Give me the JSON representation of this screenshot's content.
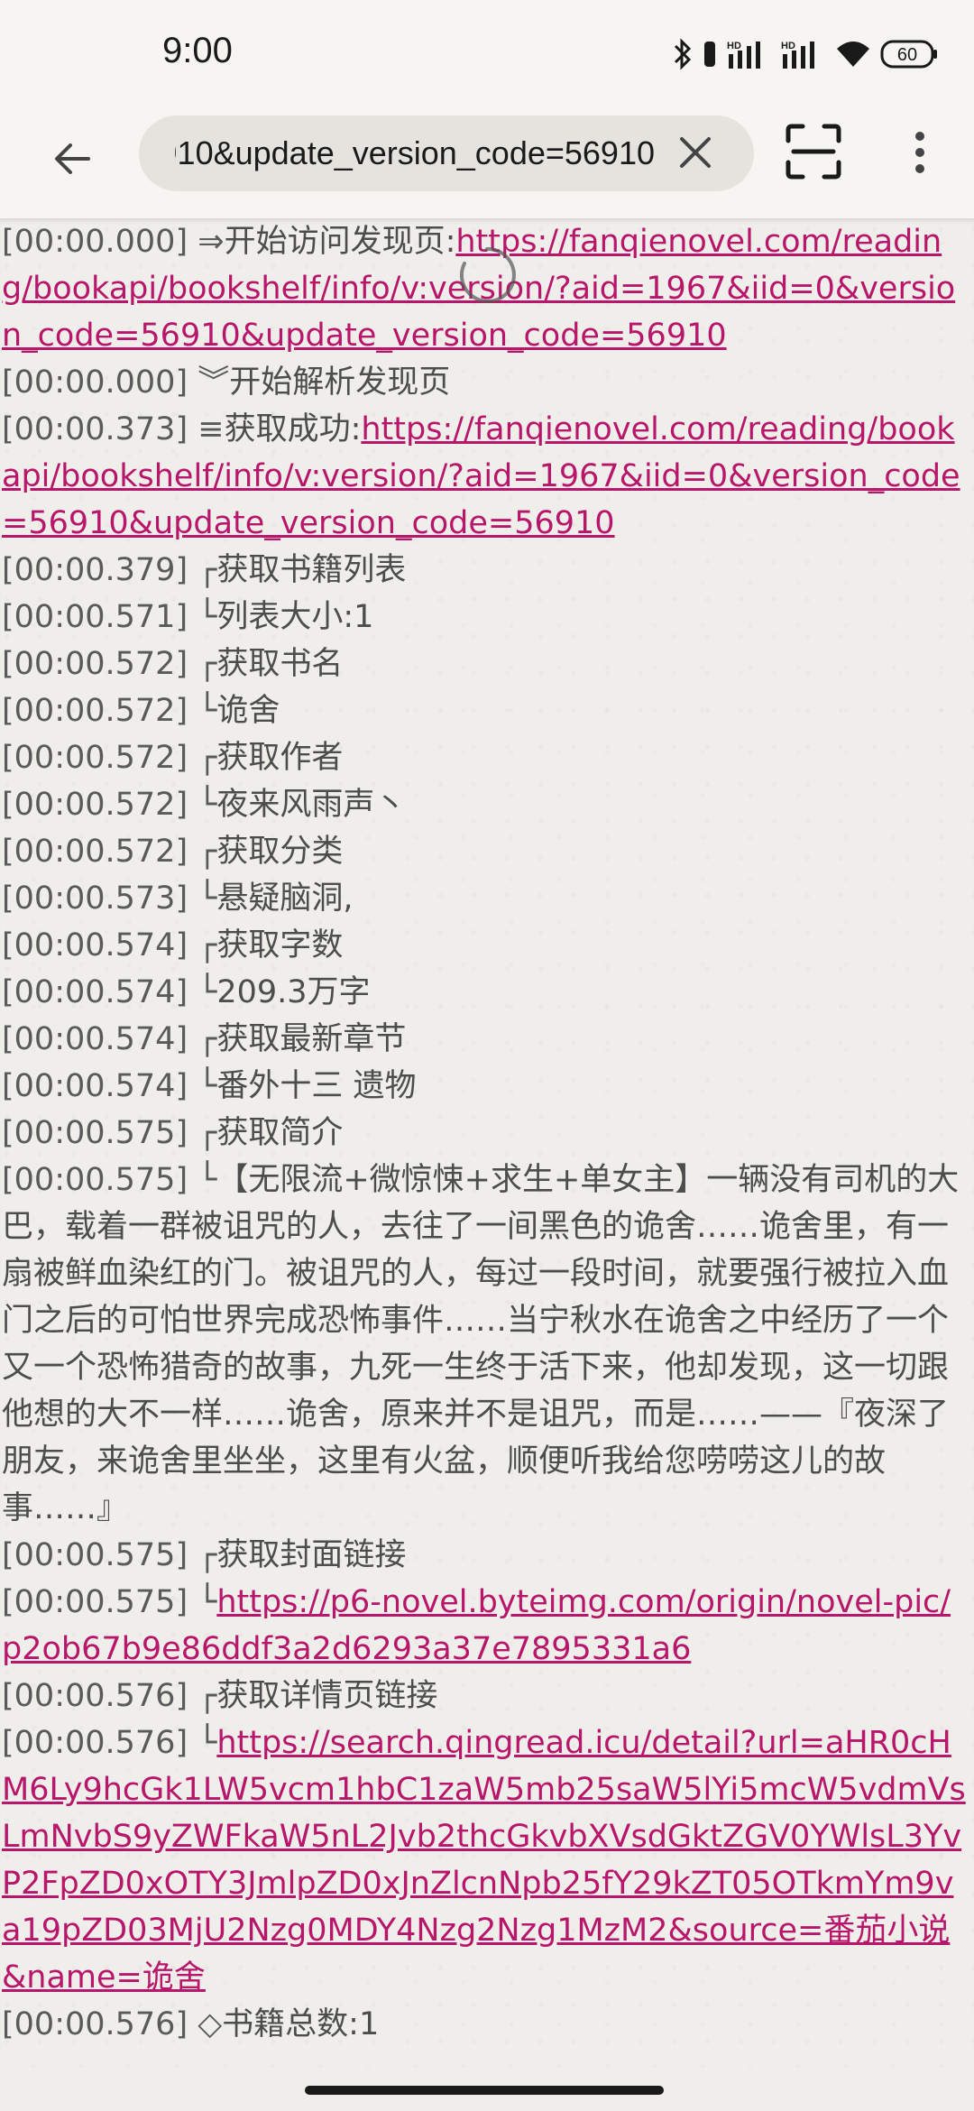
{
  "status_bar": {
    "time": "9:00",
    "battery": "60",
    "icons": [
      "bluetooth-icon",
      "vibrate-icon",
      "hd-signal-icon",
      "hd-signal-icon",
      "wifi-icon",
      "battery-icon"
    ]
  },
  "toolbar": {
    "url": "https://fanqienovel.com/reading/bookapi/bookshelf/info/v:version/?aid=1967&iid=0&version_code=56910&update_version_code=56910",
    "back_icon": "arrow-left-icon",
    "clear_icon": "close-icon",
    "scan_icon": "scan-icon",
    "more_icon": "more-vert-icon"
  },
  "log": [
    {
      "ts": "[00:00.000]",
      "marker": " ⇒",
      "text": "开始访问发现页:",
      "link": "https://fanqienovel.com/reading/bookapi/bookshelf/info/v:version/?aid=1967&iid=0&version_code=56910&update_version_code=56910"
    },
    {
      "ts": "[00:00.000]",
      "marker": " ︾",
      "text": "开始解析发现页",
      "link": ""
    },
    {
      "ts": "[00:00.373]",
      "marker": " ≡",
      "text": "获取成功:",
      "link": "https://fanqienovel.com/reading/bookapi/bookshelf/info/v:version/?aid=1967&iid=0&version_code=56910&update_version_code=56910"
    },
    {
      "ts": "[00:00.379]",
      "marker": " ┌",
      "text": "获取书籍列表",
      "link": ""
    },
    {
      "ts": "[00:00.571]",
      "marker": " └",
      "text": "列表大小:1",
      "link": ""
    },
    {
      "ts": "[00:00.572]",
      "marker": " ┌",
      "text": "获取书名",
      "link": ""
    },
    {
      "ts": "[00:00.572]",
      "marker": " └",
      "text": "诡舍",
      "link": ""
    },
    {
      "ts": "[00:00.572]",
      "marker": " ┌",
      "text": "获取作者",
      "link": ""
    },
    {
      "ts": "[00:00.572]",
      "marker": " └",
      "text": "夜来风雨声丶",
      "link": ""
    },
    {
      "ts": "[00:00.572]",
      "marker": " ┌",
      "text": "获取分类",
      "link": ""
    },
    {
      "ts": "[00:00.573]",
      "marker": " └",
      "text": "悬疑脑洞,",
      "link": ""
    },
    {
      "ts": "[00:00.574]",
      "marker": " ┌",
      "text": "获取字数",
      "link": ""
    },
    {
      "ts": "[00:00.574]",
      "marker": " └",
      "text": "209.3万字",
      "link": ""
    },
    {
      "ts": "[00:00.574]",
      "marker": " ┌",
      "text": "获取最新章节",
      "link": ""
    },
    {
      "ts": "[00:00.574]",
      "marker": " └",
      "text": "番外十三 遗物",
      "link": ""
    },
    {
      "ts": "[00:00.575]",
      "marker": " ┌",
      "text": "获取简介",
      "link": ""
    },
    {
      "ts": "[00:00.575]",
      "marker": " └",
      "text": "【无限流+微惊悚+求生+单女主】一辆没有司机的大巴，载着一群被诅咒的人，去往了一间黑色的诡舍……诡舍里，有一扇被鲜血染红的门。被诅咒的人，每过一段时间，就要强行被拉入血门之后的可怕世界完成恐怖事件……当宁秋水在诡舍之中经历了一个又一个恐怖猎奇的故事，九死一生终于活下来，他却发现，这一切跟他想的大不一样……诡舍，原来并不是诅咒，而是……——『夜深了朋友，来诡舍里坐坐，这里有火盆，顺便听我给您唠唠这儿的故事……』",
      "link": ""
    },
    {
      "ts": "[00:00.575]",
      "marker": " ┌",
      "text": "获取封面链接",
      "link": ""
    },
    {
      "ts": "[00:00.575]",
      "marker": " └",
      "text": "",
      "link": "https://p6-novel.byteimg.com/origin/novel-pic/p2ob67b9e86ddf3a2d6293a37e7895331a6"
    },
    {
      "ts": "[00:00.576]",
      "marker": " ┌",
      "text": "获取详情页链接",
      "link": ""
    },
    {
      "ts": "[00:00.576]",
      "marker": " └",
      "text": "",
      "link": "https://search.qingread.icu/detail?url=aHR0cHM6Ly9hcGk1LW5vcm1hbC1zaW5mb25saW5lYi5mcW5vdmVsLmNvbS9yZWFkaW5nL2Jvb2thcGkvbXVsdGktZGV0YWlsL3YvP2FpZD0xOTY3JmlpZD0xJnZlcnNpb25fY29kZT05OTkmYm9va19pZD03MjU2Nzg0MDY4Nzg2Nzg1MzM2&source=番茄小说&name=诡舍"
    },
    {
      "ts": "[00:00.576]",
      "marker": " ◇",
      "text": "书籍总数:1",
      "link": ""
    }
  ]
}
